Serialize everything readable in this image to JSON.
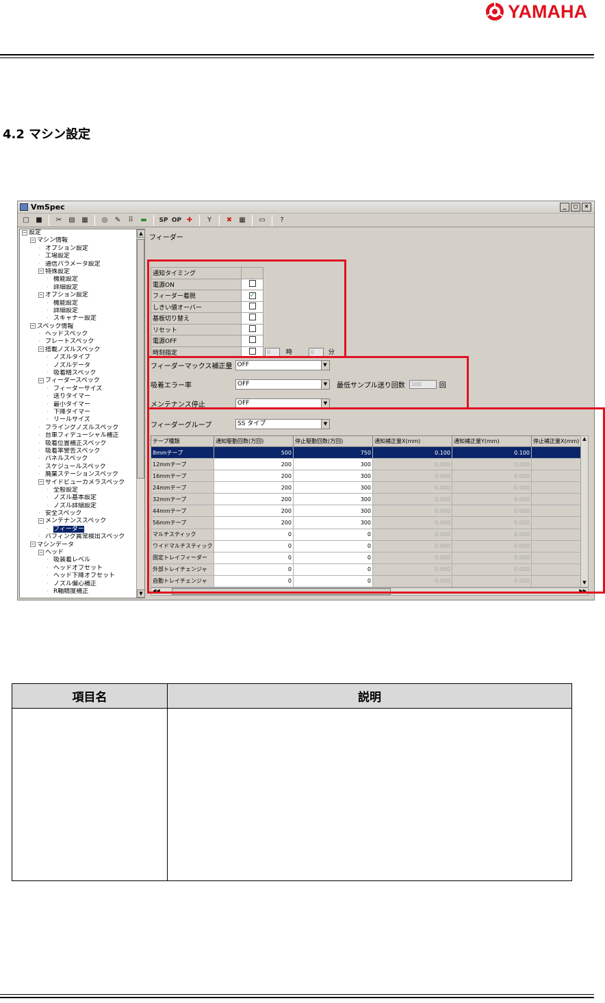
{
  "header": {
    "brand": "YAMAHA"
  },
  "section": {
    "title": "4.2  マシン設定"
  },
  "window": {
    "title": "VmSpec",
    "controls": [
      "_",
      "□",
      "×"
    ],
    "toolbar": [
      "□",
      "■",
      "✂",
      "▤",
      "▦",
      "◎",
      "✎",
      "⠿",
      "▬",
      "SP",
      "OP",
      "✚",
      "Y",
      "✖",
      "▦",
      "▭",
      "?"
    ]
  },
  "tree": {
    "items": [
      {
        "text": "設定",
        "level": 0,
        "exp": "−"
      },
      {
        "text": "マシン情報",
        "level": 1,
        "exp": "−"
      },
      {
        "text": "オプション設定",
        "level": 2,
        "exp": ""
      },
      {
        "text": "工場設定",
        "level": 2,
        "exp": ""
      },
      {
        "text": "通信パラメータ設定",
        "level": 2,
        "exp": ""
      },
      {
        "text": "特殊設定",
        "level": 2,
        "exp": "−"
      },
      {
        "text": "機能設定",
        "level": 3,
        "exp": ""
      },
      {
        "text": "詳細設定",
        "level": 3,
        "exp": ""
      },
      {
        "text": "オプション設定",
        "level": 2,
        "exp": "−"
      },
      {
        "text": "機能設定",
        "level": 3,
        "exp": ""
      },
      {
        "text": "詳細設定",
        "level": 3,
        "exp": ""
      },
      {
        "text": "スキャナー設定",
        "level": 3,
        "exp": ""
      },
      {
        "text": "スペック情報",
        "level": 1,
        "exp": "−"
      },
      {
        "text": "ヘッドスペック",
        "level": 2,
        "exp": ""
      },
      {
        "text": "プレートスペック",
        "level": 2,
        "exp": ""
      },
      {
        "text": "搭載ノズルスペック",
        "level": 2,
        "exp": "−"
      },
      {
        "text": "ノズルタイプ",
        "level": 3,
        "exp": ""
      },
      {
        "text": "ノズルデータ",
        "level": 3,
        "exp": ""
      },
      {
        "text": "吸着精スペック",
        "level": 3,
        "exp": ""
      },
      {
        "text": "フィーダースペック",
        "level": 2,
        "exp": "−"
      },
      {
        "text": "フィーダーサイズ",
        "level": 3,
        "exp": ""
      },
      {
        "text": "送りタイマー",
        "level": 3,
        "exp": ""
      },
      {
        "text": "最小タイマー",
        "level": 3,
        "exp": ""
      },
      {
        "text": "下降タイマー",
        "level": 3,
        "exp": ""
      },
      {
        "text": "リールサイズ",
        "level": 3,
        "exp": ""
      },
      {
        "text": "フライングノズルスペック",
        "level": 2,
        "exp": ""
      },
      {
        "text": "台車フィデューシャル補正",
        "level": 2,
        "exp": ""
      },
      {
        "text": "吸着位置補正スペック",
        "level": 2,
        "exp": ""
      },
      {
        "text": "吸着率警告スペック",
        "level": 2,
        "exp": ""
      },
      {
        "text": "パネルスペック",
        "level": 2,
        "exp": ""
      },
      {
        "text": "スケジュールスペック",
        "level": 2,
        "exp": ""
      },
      {
        "text": "廃棄ステーションスペック",
        "level": 2,
        "exp": ""
      },
      {
        "text": "サイドビューカメラスペック",
        "level": 2,
        "exp": "−"
      },
      {
        "text": "全般設定",
        "level": 3,
        "exp": ""
      },
      {
        "text": "ノズル基本設定",
        "level": 3,
        "exp": ""
      },
      {
        "text": "ノズル詳細設定",
        "level": 3,
        "exp": ""
      },
      {
        "text": "安全スペック",
        "level": 2,
        "exp": ""
      },
      {
        "text": "メンテナンススペック",
        "level": 2,
        "exp": "−"
      },
      {
        "text": "フィーダー",
        "level": 3,
        "exp": "",
        "selected": true
      },
      {
        "text": "バフィング異常検出スペック",
        "level": 2,
        "exp": ""
      },
      {
        "text": "マシンデータ",
        "level": 1,
        "exp": "−"
      },
      {
        "text": "ヘッド",
        "level": 2,
        "exp": "−"
      },
      {
        "text": "吸装着レベル",
        "level": 3,
        "exp": ""
      },
      {
        "text": "ヘッドオフセット",
        "level": 3,
        "exp": ""
      },
      {
        "text": "ヘッド下降オフセット",
        "level": 3,
        "exp": ""
      },
      {
        "text": "ノズル偏心補正",
        "level": 3,
        "exp": ""
      },
      {
        "text": "R軸精度補正",
        "level": 3,
        "exp": ""
      }
    ]
  },
  "panel": {
    "title": "フィーダー",
    "notify": {
      "header": "通知タイミング",
      "rows": [
        {
          "label": "電源ON",
          "checked": false
        },
        {
          "label": "フィーダー着脱",
          "checked": true
        },
        {
          "label": "しきい値オーバー",
          "checked": false
        },
        {
          "label": "基板切り替え",
          "checked": false
        },
        {
          "label": "リセット",
          "checked": false
        },
        {
          "label": "電源OFF",
          "checked": false
        },
        {
          "label": "時刻指定",
          "checked": false
        }
      ],
      "hour_value": "0",
      "hour_unit": "時",
      "min_value": "0",
      "min_unit": "分"
    },
    "fields": {
      "max_corr_label": "フィーダーマックス補正量",
      "max_corr_value": "OFF",
      "err_rate_label": "吸着エラー率",
      "err_rate_value": "OFF",
      "min_sample_label": "最低サンプル送り回数",
      "min_sample_value": "100",
      "min_sample_unit": "回",
      "maint_stop_label": "メンテナンス停止",
      "maint_stop_value": "OFF",
      "group_label": "フィーダーグループ",
      "group_value": "SS タイプ"
    },
    "grid": {
      "columns": [
        "テープ種類",
        "通知駆動回数(万回)",
        "停止駆動回数(万回)",
        "通知補正量X(mm)",
        "通知補正量Y(mm)",
        "停止補正量X(mm)"
      ],
      "rows": [
        [
          "8mmテープ",
          "500",
          "750",
          "0.100",
          "0.100",
          ""
        ],
        [
          "12mmテープ",
          "200",
          "300",
          "0.000",
          "0.000",
          ""
        ],
        [
          "16mmテープ",
          "200",
          "300",
          "0.000",
          "0.000",
          ""
        ],
        [
          "24mmテープ",
          "200",
          "300",
          "0.000",
          "0.000",
          ""
        ],
        [
          "32mmテープ",
          "200",
          "300",
          "0.000",
          "0.000",
          ""
        ],
        [
          "44mmテープ",
          "200",
          "300",
          "0.000",
          "0.000",
          ""
        ],
        [
          "56mmテープ",
          "200",
          "300",
          "0.000",
          "0.000",
          ""
        ],
        [
          "マルチスティック",
          "0",
          "0",
          "0.000",
          "0.000",
          ""
        ],
        [
          "ワイドマルチスティック",
          "0",
          "0",
          "0.000",
          "0.000",
          ""
        ],
        [
          "固定トレイフィーダー",
          "0",
          "0",
          "0.000",
          "0.000",
          ""
        ],
        [
          "外部トレイチェンジャ",
          "0",
          "0",
          "0.000",
          "0.000",
          ""
        ],
        [
          "自動トレイチェンジャ",
          "0",
          "0",
          "0.000",
          "0.000",
          ""
        ]
      ]
    }
  },
  "desc_table": {
    "headers": [
      "項目名",
      "説明"
    ]
  }
}
